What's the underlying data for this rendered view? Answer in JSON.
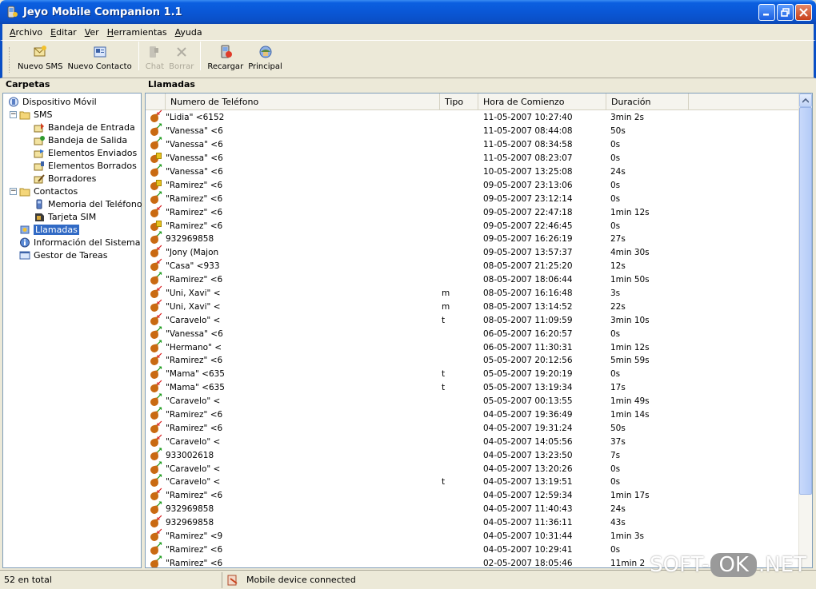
{
  "window": {
    "title": "Jeyo Mobile Companion 1.1"
  },
  "menu": [
    "Archivo",
    "Editar",
    "Ver",
    "Herramientas",
    "Ayuda"
  ],
  "toolbar": [
    {
      "label": "Nuevo SMS",
      "icon": "new-sms-icon",
      "enabled": true
    },
    {
      "label": "Nuevo Contacto",
      "icon": "new-contact-icon",
      "enabled": true
    },
    {
      "label": "Chat",
      "icon": "chat-icon",
      "enabled": false
    },
    {
      "label": "Borrar",
      "icon": "delete-icon",
      "enabled": false
    },
    {
      "label": "Recargar",
      "icon": "reload-icon",
      "enabled": true
    },
    {
      "label": "Principal",
      "icon": "home-icon",
      "enabled": true
    }
  ],
  "left_pane": {
    "header": "Carpetas",
    "tree": [
      {
        "label": "Dispositivo Móvil",
        "icon": "mobile-device-icon",
        "level": 0
      },
      {
        "label": "SMS",
        "icon": "folder-icon",
        "level": 1,
        "expander": "−"
      },
      {
        "label": "Bandeja de Entrada",
        "icon": "inbox-icon",
        "level": 2
      },
      {
        "label": "Bandeja de Salida",
        "icon": "outbox-icon",
        "level": 2
      },
      {
        "label": "Elementos Enviados",
        "icon": "sent-icon",
        "level": 2
      },
      {
        "label": "Elementos Borrados",
        "icon": "deleted-icon",
        "level": 2
      },
      {
        "label": "Borradores",
        "icon": "drafts-icon",
        "level": 2
      },
      {
        "label": "Contactos",
        "icon": "folder-icon",
        "level": 1,
        "expander": "−"
      },
      {
        "label": "Memoria del Teléfono",
        "icon": "phone-memory-icon",
        "level": 2
      },
      {
        "label": "Tarjeta SIM",
        "icon": "sim-card-icon",
        "level": 2
      },
      {
        "label": "Llamadas",
        "icon": "calls-icon",
        "level": 1,
        "selected": true
      },
      {
        "label": "Información del Sistema",
        "icon": "system-info-icon",
        "level": 1
      },
      {
        "label": "Gestor de Tareas",
        "icon": "task-manager-icon",
        "level": 1
      }
    ]
  },
  "right_pane": {
    "header": "Llamadas",
    "columns": [
      "Numero de Teléfono",
      "Tipo",
      "Hora de Comienzo",
      "Duración"
    ],
    "rows": [
      {
        "icon": "missed",
        "num": "\"Lidia\" <6152",
        "tipo": "",
        "hora": "11-05-2007 10:27:40",
        "dur": "3min 2s"
      },
      {
        "icon": "out",
        "num": "\"Vanessa\" <6",
        "tipo": "",
        "hora": "11-05-2007 08:44:08",
        "dur": "50s"
      },
      {
        "icon": "out",
        "num": "\"Vanessa\" <6",
        "tipo": "",
        "hora": "11-05-2007 08:34:58",
        "dur": "0s"
      },
      {
        "icon": "miss2",
        "num": "\"Vanessa\" <6",
        "tipo": "",
        "hora": "11-05-2007 08:23:07",
        "dur": "0s"
      },
      {
        "icon": "out",
        "num": "\"Vanessa\" <6",
        "tipo": "",
        "hora": "10-05-2007 13:25:08",
        "dur": "24s"
      },
      {
        "icon": "miss2",
        "num": "\"Ramirez\" <6",
        "tipo": "",
        "hora": "09-05-2007 23:13:06",
        "dur": "0s"
      },
      {
        "icon": "out",
        "num": "\"Ramirez\" <6",
        "tipo": "",
        "hora": "09-05-2007 23:12:14",
        "dur": "0s"
      },
      {
        "icon": "missed",
        "num": "\"Ramirez\" <6",
        "tipo": "",
        "hora": "09-05-2007 22:47:18",
        "dur": "1min 12s"
      },
      {
        "icon": "miss2",
        "num": "\"Ramirez\" <6",
        "tipo": "",
        "hora": "09-05-2007 22:46:45",
        "dur": "0s"
      },
      {
        "icon": "out",
        "num": "932969858",
        "tipo": "",
        "hora": "09-05-2007 16:26:19",
        "dur": "27s"
      },
      {
        "icon": "missed",
        "num": "\"Jony (Majon",
        "tipo": "",
        "hora": "09-05-2007 13:57:37",
        "dur": "4min 30s"
      },
      {
        "icon": "missed",
        "num": "\"Casa\" <933",
        "tipo": "",
        "hora": "08-05-2007 21:25:20",
        "dur": "12s"
      },
      {
        "icon": "out",
        "num": "\"Ramirez\" <6",
        "tipo": "",
        "hora": "08-05-2007 18:06:44",
        "dur": "1min 50s"
      },
      {
        "icon": "missed",
        "num": "\"Uni, Xavi\" <",
        "tipo": "m",
        "hora": "08-05-2007 16:16:48",
        "dur": "3s"
      },
      {
        "icon": "missed",
        "num": "\"Uni, Xavi\" <",
        "tipo": "m",
        "hora": "08-05-2007 13:14:52",
        "dur": "22s"
      },
      {
        "icon": "missed",
        "num": "\"Caravelo\" <",
        "tipo": "t",
        "hora": "08-05-2007 11:09:59",
        "dur": "3min 10s"
      },
      {
        "icon": "out",
        "num": "\"Vanessa\" <6",
        "tipo": "",
        "hora": "06-05-2007 16:20:57",
        "dur": "0s"
      },
      {
        "icon": "out",
        "num": "\"Hermano\" <",
        "tipo": "",
        "hora": "06-05-2007 11:30:31",
        "dur": "1min 12s"
      },
      {
        "icon": "missed",
        "num": "\"Ramirez\" <6",
        "tipo": "",
        "hora": "05-05-2007 20:12:56",
        "dur": "5min 59s"
      },
      {
        "icon": "out",
        "num": "\"Mama\" <635",
        "tipo": "t",
        "hora": "05-05-2007 19:20:19",
        "dur": "0s"
      },
      {
        "icon": "missed",
        "num": "\"Mama\" <635",
        "tipo": "t",
        "hora": "05-05-2007 13:19:34",
        "dur": "17s"
      },
      {
        "icon": "out",
        "num": "\"Caravelo\" <",
        "tipo": "",
        "hora": "05-05-2007 00:13:55",
        "dur": "1min 49s"
      },
      {
        "icon": "out",
        "num": "\"Ramirez\" <6",
        "tipo": "",
        "hora": "04-05-2007 19:36:49",
        "dur": "1min 14s"
      },
      {
        "icon": "missed",
        "num": "\"Ramirez\" <6",
        "tipo": "",
        "hora": "04-05-2007 19:31:24",
        "dur": "50s"
      },
      {
        "icon": "missed",
        "num": "\"Caravelo\" <",
        "tipo": "",
        "hora": "04-05-2007 14:05:56",
        "dur": "37s"
      },
      {
        "icon": "out",
        "num": "933002618",
        "tipo": "",
        "hora": "04-05-2007 13:23:50",
        "dur": "7s"
      },
      {
        "icon": "out",
        "num": "\"Caravelo\" <",
        "tipo": "",
        "hora": "04-05-2007 13:20:26",
        "dur": "0s"
      },
      {
        "icon": "out",
        "num": "\"Caravelo\" <",
        "tipo": "t",
        "hora": "04-05-2007 13:19:51",
        "dur": "0s"
      },
      {
        "icon": "missed",
        "num": "\"Ramirez\" <6",
        "tipo": "",
        "hora": "04-05-2007 12:59:34",
        "dur": "1min 17s"
      },
      {
        "icon": "out",
        "num": "932969858",
        "tipo": "",
        "hora": "04-05-2007 11:40:43",
        "dur": "24s"
      },
      {
        "icon": "missed",
        "num": "932969858",
        "tipo": "",
        "hora": "04-05-2007 11:36:11",
        "dur": "43s"
      },
      {
        "icon": "missed",
        "num": "\"Ramirez\" <9",
        "tipo": "",
        "hora": "04-05-2007 10:31:44",
        "dur": "1min 3s"
      },
      {
        "icon": "out",
        "num": "\"Ramirez\" <6",
        "tipo": "",
        "hora": "04-05-2007 10:29:41",
        "dur": "0s"
      },
      {
        "icon": "out",
        "num": "\"Ramirez\" <6",
        "tipo": "",
        "hora": "02-05-2007 18:05:46",
        "dur": "11min 2"
      }
    ]
  },
  "status": {
    "count": "52 en total",
    "device": "Mobile device connected"
  },
  "watermark": {
    "left": "SOFT-",
    "ok": "OK",
    "right": ".NET"
  }
}
